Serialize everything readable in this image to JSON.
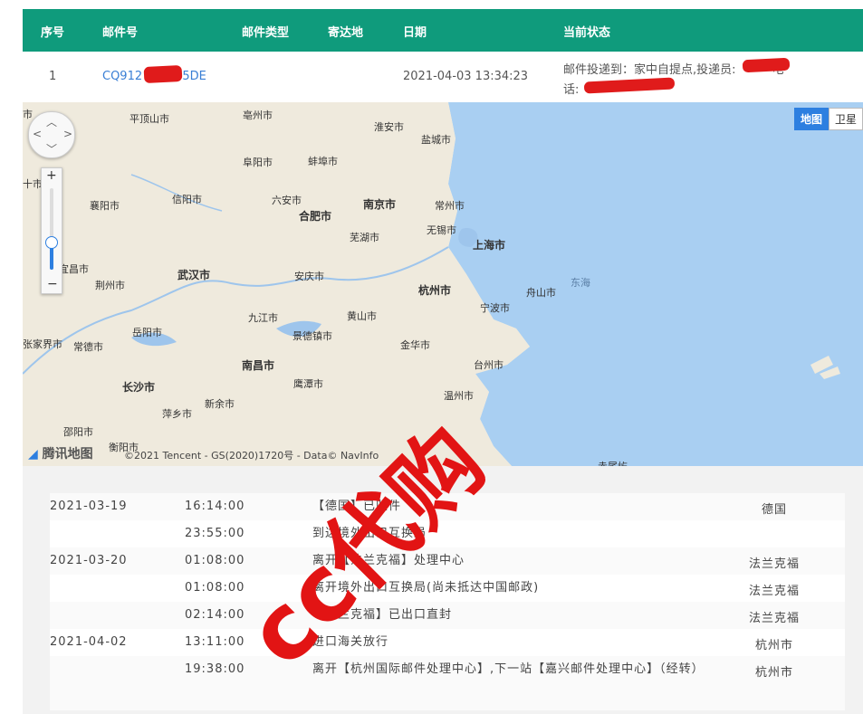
{
  "header": {
    "col_seq": "序号",
    "col_number": "邮件号",
    "col_type": "邮件类型",
    "col_dest": "寄达地",
    "col_date": "日期",
    "col_status": "当前状态",
    "bg_color": "#0f9b7c"
  },
  "mail": {
    "seq": "1",
    "number_prefix": "CQ912",
    "number_suffix": "45DE",
    "type": "",
    "dest": "",
    "date": "2021-04-03 13:34:23",
    "status_line1": "邮件投递到：家中自提点,投递员:",
    "status_line1_tail": "电",
    "status_line2": "话:"
  },
  "map": {
    "type_map": "地图",
    "type_satellite": "卫星",
    "zoom_in": "+",
    "zoom_out": "−",
    "zoom_level_fraction": 0.35,
    "logo": "腾讯地图",
    "copyright": "©2021 Tencent - GS(2020)1720号 - Data© NavInfo",
    "cities": [
      {
        "name": "平顶山市",
        "big": false
      },
      {
        "name": "亳州市",
        "big": false
      },
      {
        "name": "淮安市",
        "big": false
      },
      {
        "name": "盐城市",
        "big": false
      },
      {
        "name": "阜阳市",
        "big": false
      },
      {
        "name": "蚌埠市",
        "big": false
      },
      {
        "name": "信阳市",
        "big": false
      },
      {
        "name": "襄阳市",
        "big": false
      },
      {
        "name": "六安市",
        "big": false
      },
      {
        "name": "合肥市",
        "big": true
      },
      {
        "name": "南京市",
        "big": true
      },
      {
        "name": "常州市",
        "big": false
      },
      {
        "name": "无锡市",
        "big": false
      },
      {
        "name": "芜湖市",
        "big": false
      },
      {
        "name": "上海市",
        "big": true
      },
      {
        "name": "武汉市",
        "big": true
      },
      {
        "name": "荆州市",
        "big": false
      },
      {
        "name": "安庆市",
        "big": false
      },
      {
        "name": "杭州市",
        "big": true
      },
      {
        "name": "舟山市",
        "big": false
      },
      {
        "name": "宜昌市",
        "big": false
      },
      {
        "name": "宁波市",
        "big": false
      },
      {
        "name": "九江市",
        "big": false
      },
      {
        "name": "黄山市",
        "big": false
      },
      {
        "name": "岳阳市",
        "big": false
      },
      {
        "name": "常德市",
        "big": false
      },
      {
        "name": "景德镇市",
        "big": false
      },
      {
        "name": "金华市",
        "big": false
      },
      {
        "name": "张家界市",
        "big": false
      },
      {
        "name": "南昌市",
        "big": true
      },
      {
        "name": "台州市",
        "big": false
      },
      {
        "name": "长沙市",
        "big": true
      },
      {
        "name": "鹰潭市",
        "big": false
      },
      {
        "name": "温州市",
        "big": false
      },
      {
        "name": "新余市",
        "big": false
      },
      {
        "name": "萍乡市",
        "big": false
      },
      {
        "name": "邵阳市",
        "big": false
      },
      {
        "name": "衡阳市",
        "big": false
      },
      {
        "name": "十市",
        "big": false
      },
      {
        "name": "市",
        "big": false
      },
      {
        "name": "赤尾屿",
        "big": false
      }
    ],
    "sea": "东海"
  },
  "tracking": [
    {
      "date": "2021-03-19",
      "time": "16:14:00",
      "event": "【德国】已收件",
      "loc": "德国"
    },
    {
      "date": "",
      "time": "23:55:00",
      "event": "到达境外出口互换局",
      "loc": ""
    },
    {
      "date": "2021-03-20",
      "time": "01:08:00",
      "event": "离开【法兰克福】处理中心",
      "loc": "法兰克福"
    },
    {
      "date": "",
      "time": "01:08:00",
      "event": "离开境外出口互换局(尚未抵达中国邮政)",
      "loc": "法兰克福"
    },
    {
      "date": "",
      "time": "02:14:00",
      "event": "【法兰克福】已出口直封",
      "loc": "法兰克福"
    },
    {
      "date": "2021-04-02",
      "time": "13:11:00",
      "event": "进口海关放行",
      "loc": "杭州市"
    },
    {
      "date": "",
      "time": "19:38:00",
      "event": "离开【杭州国际邮件处理中心】,下一站【嘉兴邮件处理中心】（经转）",
      "loc": "杭州市"
    }
  ],
  "watermark": "cc代购",
  "colors": {
    "accent": "#0f9b7c",
    "link": "#3a7fd5",
    "watermark": "#e21414",
    "map_blue": "#2d7fe0",
    "sea": "#a9cff2"
  }
}
